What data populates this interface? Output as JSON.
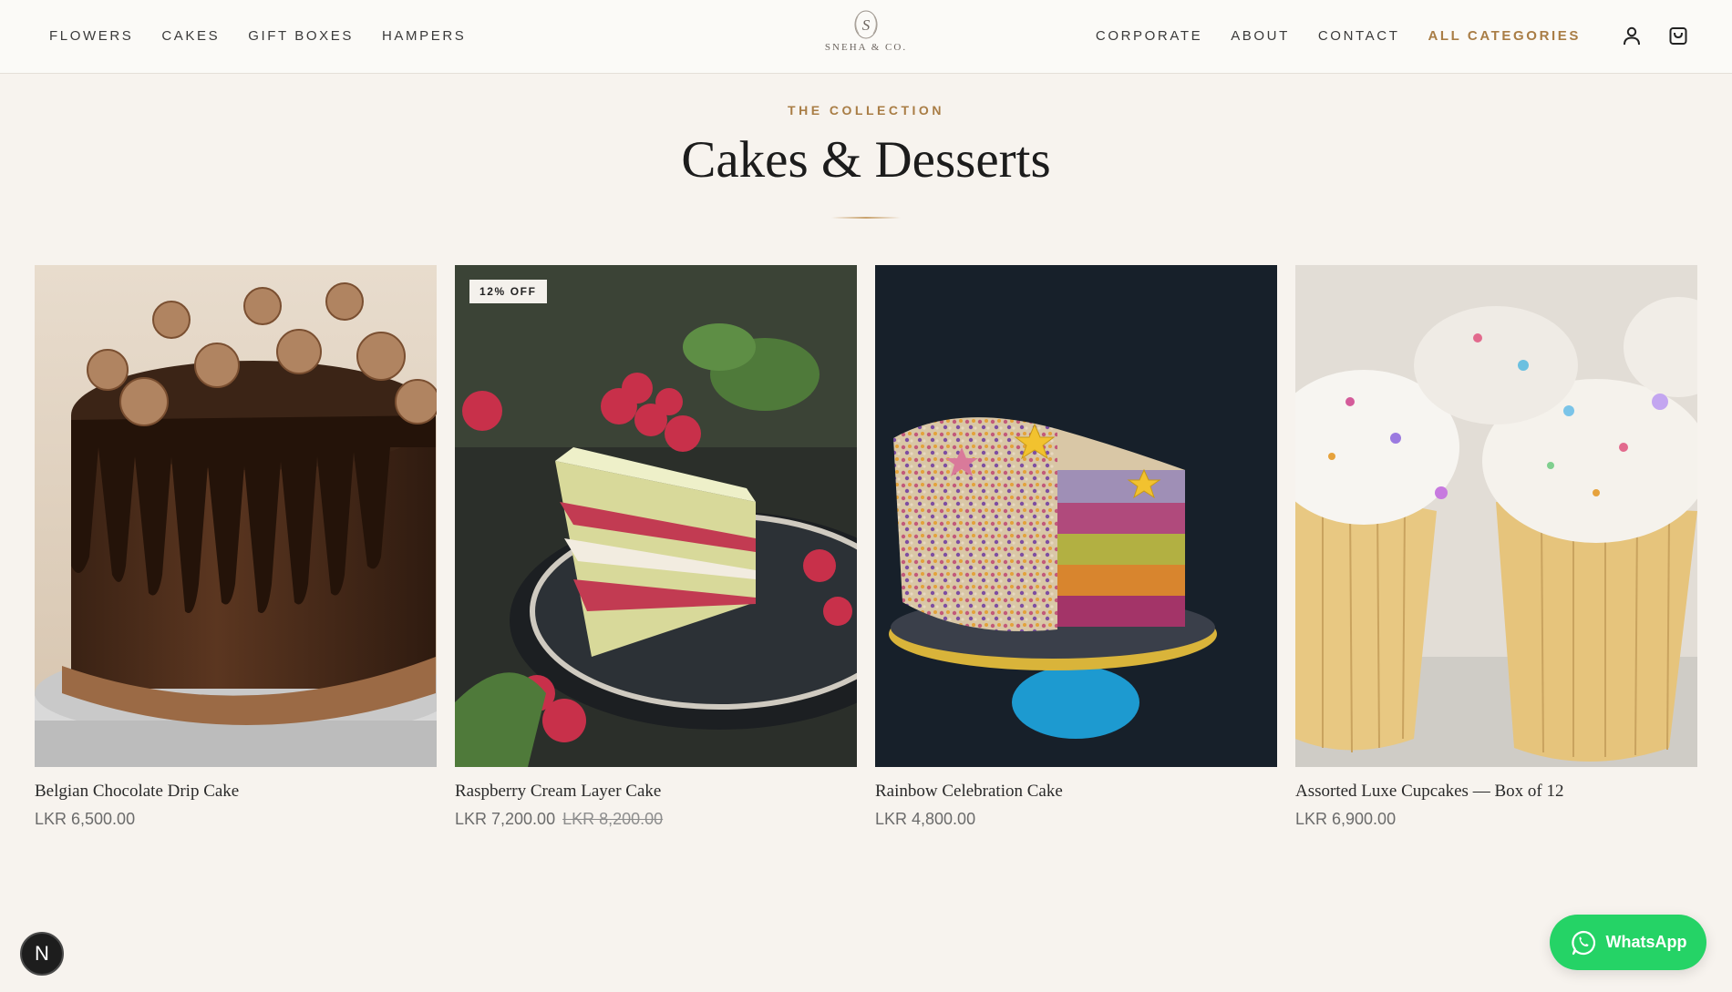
{
  "header": {
    "nav_left": [
      {
        "label": "FLOWERS"
      },
      {
        "label": "CAKES"
      },
      {
        "label": "GIFT BOXES"
      },
      {
        "label": "HAMPERS"
      }
    ],
    "nav_right": [
      {
        "label": "CORPORATE"
      },
      {
        "label": "ABOUT"
      },
      {
        "label": "CONTACT"
      },
      {
        "label": "ALL CATEGORIES"
      }
    ],
    "logo": {
      "monogram": "S",
      "text": "SNEHA & CO."
    },
    "account_icon": "user-icon",
    "cart_icon": "shopping-bag-icon",
    "accent_color": "#a97d45"
  },
  "collection": {
    "eyebrow": "THE COLLECTION",
    "title": "Cakes & Desserts"
  },
  "products": [
    {
      "name": "Belgian Chocolate Drip Cake",
      "price": "LKR 6,500.00",
      "old_price": "",
      "badge": ""
    },
    {
      "name": "Raspberry Cream Layer Cake",
      "price": "LKR 7,200.00",
      "old_price": "LKR 8,200.00",
      "badge": "12% OFF"
    },
    {
      "name": "Rainbow Celebration Cake",
      "price": "LKR 4,800.00",
      "old_price": "",
      "badge": ""
    },
    {
      "name": "Assorted Luxe Cupcakes — Box of 12",
      "price": "LKR 6,900.00",
      "old_price": "",
      "badge": ""
    }
  ],
  "floating": {
    "n_badge": "N",
    "whatsapp_label": "WhatsApp",
    "whatsapp_color": "#25d366"
  }
}
